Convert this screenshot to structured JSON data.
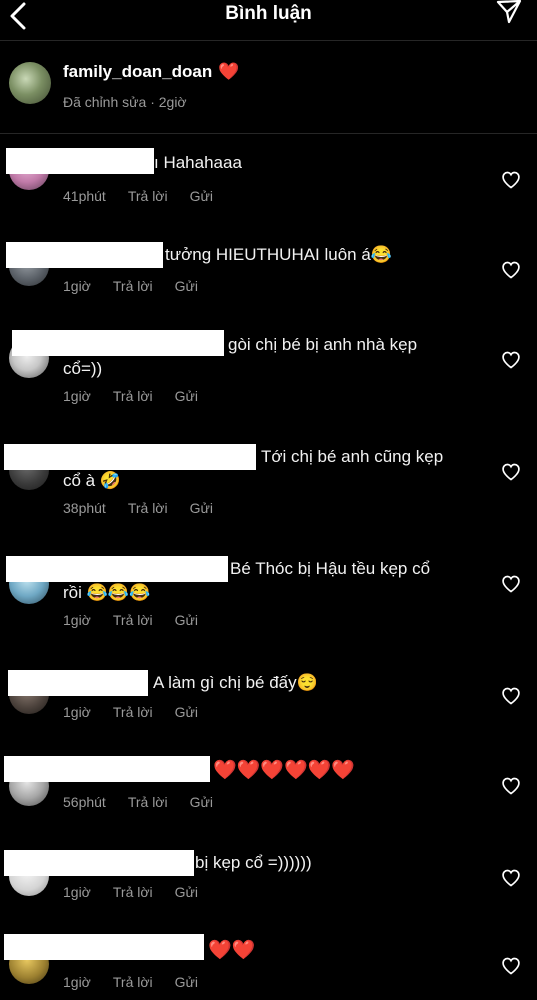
{
  "header": {
    "title": "Bình luận",
    "back_icon": "chevron-left-icon",
    "send_icon": "paper-plane-icon"
  },
  "caption": {
    "username": "family_doan_doan",
    "heart": "❤️",
    "meta": "Đã chỉnh sửa · 2giờ"
  },
  "actions": {
    "reply": "Trả lời",
    "send": "Gửi"
  },
  "comments": [
    {
      "line1": "ı Hahahaaa",
      "line2": "",
      "time": "41phút"
    },
    {
      "line1": "tưởng HIEUTHUHAI luôn á😂",
      "line2": "",
      "time": "1giờ"
    },
    {
      "line1": "gòi chị bé bị anh nhà kẹp",
      "line2": "cổ=))",
      "time": "1giờ"
    },
    {
      "line1": "Tới chị bé anh cũng kẹp",
      "line2": "cổ à 🤣",
      "time": "38phút"
    },
    {
      "line1": "Bé Thóc bị Hậu tều kẹp cổ",
      "line2": "rồi 😂😂😂",
      "time": "1giờ"
    },
    {
      "line1": "A làm gì chị bé đấy😌",
      "line2": "",
      "time": "1giờ"
    },
    {
      "line1": "❤️❤️❤️❤️❤️❤️",
      "line2": "",
      "time": "56phút"
    },
    {
      "line1": "bị kẹp cổ =))))))",
      "line2": "",
      "time": "1giờ"
    },
    {
      "line1": "❤️❤️",
      "line2": "",
      "time": "1giờ"
    }
  ]
}
